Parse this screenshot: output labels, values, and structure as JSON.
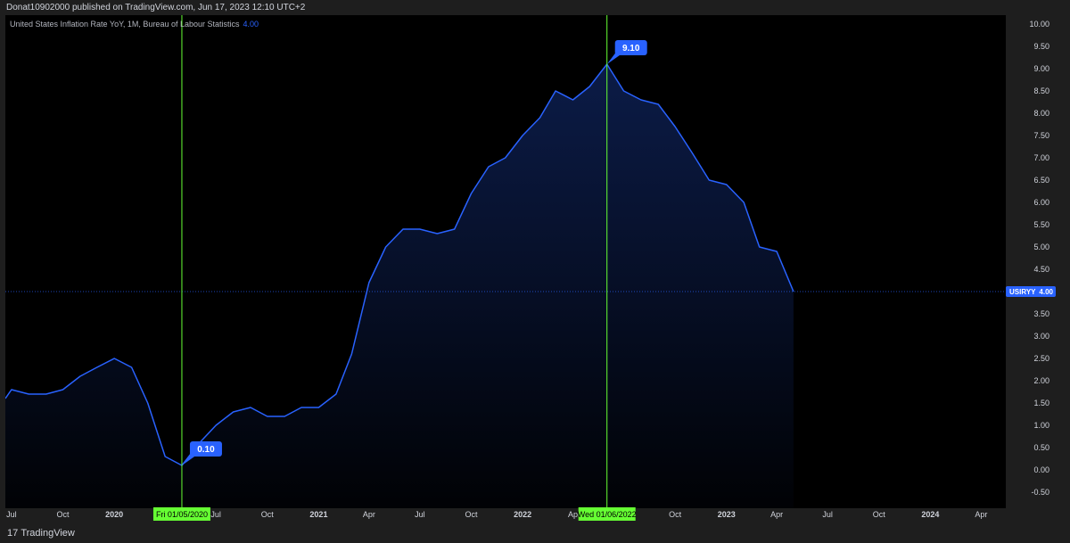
{
  "header": {
    "published": "Donat10902000 published on TradingView.com, Jun 17, 2023 12:10 UTC+2"
  },
  "footer": {
    "brand_mark": "17",
    "brand": "TradingView"
  },
  "legend": {
    "title": "United States Inflation Rate YoY, 1M, Bureau of Labour Statistics",
    "last_value": "4.00"
  },
  "colors": {
    "line": "#2962ff",
    "marker_line": "#66ff33",
    "marker_bg": "#66ff33",
    "callout": "#2962ff",
    "price_tag": "#2962ff"
  },
  "chart_data": {
    "type": "area",
    "title": "United States Inflation Rate YoY, 1M, Bureau of Labour Statistics",
    "ylim": [
      -0.7,
      10.2
    ],
    "xlim": [
      "2019-06-20",
      "2024-05-15"
    ],
    "y_ticks": [
      "10.00",
      "9.50",
      "9.00",
      "8.50",
      "8.00",
      "7.50",
      "7.00",
      "6.50",
      "6.00",
      "5.50",
      "5.00",
      "4.50",
      "4.00",
      "3.50",
      "3.00",
      "2.50",
      "2.00",
      "1.50",
      "1.00",
      "0.50",
      "0.00",
      "-0.50"
    ],
    "x_ticks": [
      {
        "label": "Jul",
        "date": "2019-07-01",
        "bold": false
      },
      {
        "label": "Oct",
        "date": "2019-10-01",
        "bold": false
      },
      {
        "label": "2020",
        "date": "2020-01-01",
        "bold": true
      },
      {
        "label": "Jul",
        "date": "2020-07-01",
        "bold": false
      },
      {
        "label": "Oct",
        "date": "2020-10-01",
        "bold": false
      },
      {
        "label": "2021",
        "date": "2021-01-01",
        "bold": true
      },
      {
        "label": "Apr",
        "date": "2021-04-01",
        "bold": false
      },
      {
        "label": "Jul",
        "date": "2021-07-01",
        "bold": false
      },
      {
        "label": "Oct",
        "date": "2021-10-01",
        "bold": false
      },
      {
        "label": "2022",
        "date": "2022-01-01",
        "bold": true
      },
      {
        "label": "Ap",
        "date": "2022-04-01",
        "bold": false
      },
      {
        "label": "Oct",
        "date": "2022-10-01",
        "bold": false
      },
      {
        "label": "2023",
        "date": "2023-01-01",
        "bold": true
      },
      {
        "label": "Apr",
        "date": "2023-04-01",
        "bold": false
      },
      {
        "label": "Jul",
        "date": "2023-07-01",
        "bold": false
      },
      {
        "label": "Oct",
        "date": "2023-10-01",
        "bold": false
      },
      {
        "label": "2024",
        "date": "2024-01-01",
        "bold": true
      },
      {
        "label": "Apr",
        "date": "2024-04-01",
        "bold": false
      }
    ],
    "series": [
      {
        "name": "USIRYY",
        "points": [
          [
            "2019-06-01",
            1.6
          ],
          [
            "2019-07-01",
            1.8
          ],
          [
            "2019-08-01",
            1.7
          ],
          [
            "2019-09-01",
            1.7
          ],
          [
            "2019-10-01",
            1.8
          ],
          [
            "2019-11-01",
            2.1
          ],
          [
            "2019-12-01",
            2.3
          ],
          [
            "2020-01-01",
            2.5
          ],
          [
            "2020-02-01",
            2.3
          ],
          [
            "2020-03-01",
            1.5
          ],
          [
            "2020-04-01",
            0.3
          ],
          [
            "2020-05-01",
            0.1
          ],
          [
            "2020-06-01",
            0.6
          ],
          [
            "2020-07-01",
            1.0
          ],
          [
            "2020-08-01",
            1.3
          ],
          [
            "2020-09-01",
            1.4
          ],
          [
            "2020-10-01",
            1.2
          ],
          [
            "2020-11-01",
            1.2
          ],
          [
            "2020-12-01",
            1.4
          ],
          [
            "2021-01-01",
            1.4
          ],
          [
            "2021-02-01",
            1.7
          ],
          [
            "2021-03-01",
            2.6
          ],
          [
            "2021-04-01",
            4.2
          ],
          [
            "2021-05-01",
            5.0
          ],
          [
            "2021-06-01",
            5.4
          ],
          [
            "2021-07-01",
            5.4
          ],
          [
            "2021-08-01",
            5.3
          ],
          [
            "2021-09-01",
            5.4
          ],
          [
            "2021-10-01",
            6.2
          ],
          [
            "2021-11-01",
            6.8
          ],
          [
            "2021-12-01",
            7.0
          ],
          [
            "2022-01-01",
            7.5
          ],
          [
            "2022-02-01",
            7.9
          ],
          [
            "2022-03-01",
            8.5
          ],
          [
            "2022-04-01",
            8.3
          ],
          [
            "2022-05-01",
            8.6
          ],
          [
            "2022-06-01",
            9.1
          ],
          [
            "2022-07-01",
            8.5
          ],
          [
            "2022-08-01",
            8.3
          ],
          [
            "2022-09-01",
            8.2
          ],
          [
            "2022-10-01",
            7.7
          ],
          [
            "2022-11-01",
            7.1
          ],
          [
            "2022-12-01",
            6.5
          ],
          [
            "2023-01-01",
            6.4
          ],
          [
            "2023-02-01",
            6.0
          ],
          [
            "2023-03-01",
            5.0
          ],
          [
            "2023-04-01",
            4.9
          ],
          [
            "2023-05-01",
            4.0
          ]
        ]
      }
    ],
    "last_value_label": "4.00",
    "price_tag_name": "USIRYY",
    "markers": [
      {
        "date": "2020-05-01",
        "date_label": "Fri 01/05/2020",
        "value_label": "0.10",
        "value": 0.1,
        "callout_side": "right"
      },
      {
        "date": "2022-06-01",
        "date_label": "Wed 01/06/2022",
        "value_label": "9.10",
        "value": 9.1,
        "callout_side": "right"
      }
    ]
  }
}
